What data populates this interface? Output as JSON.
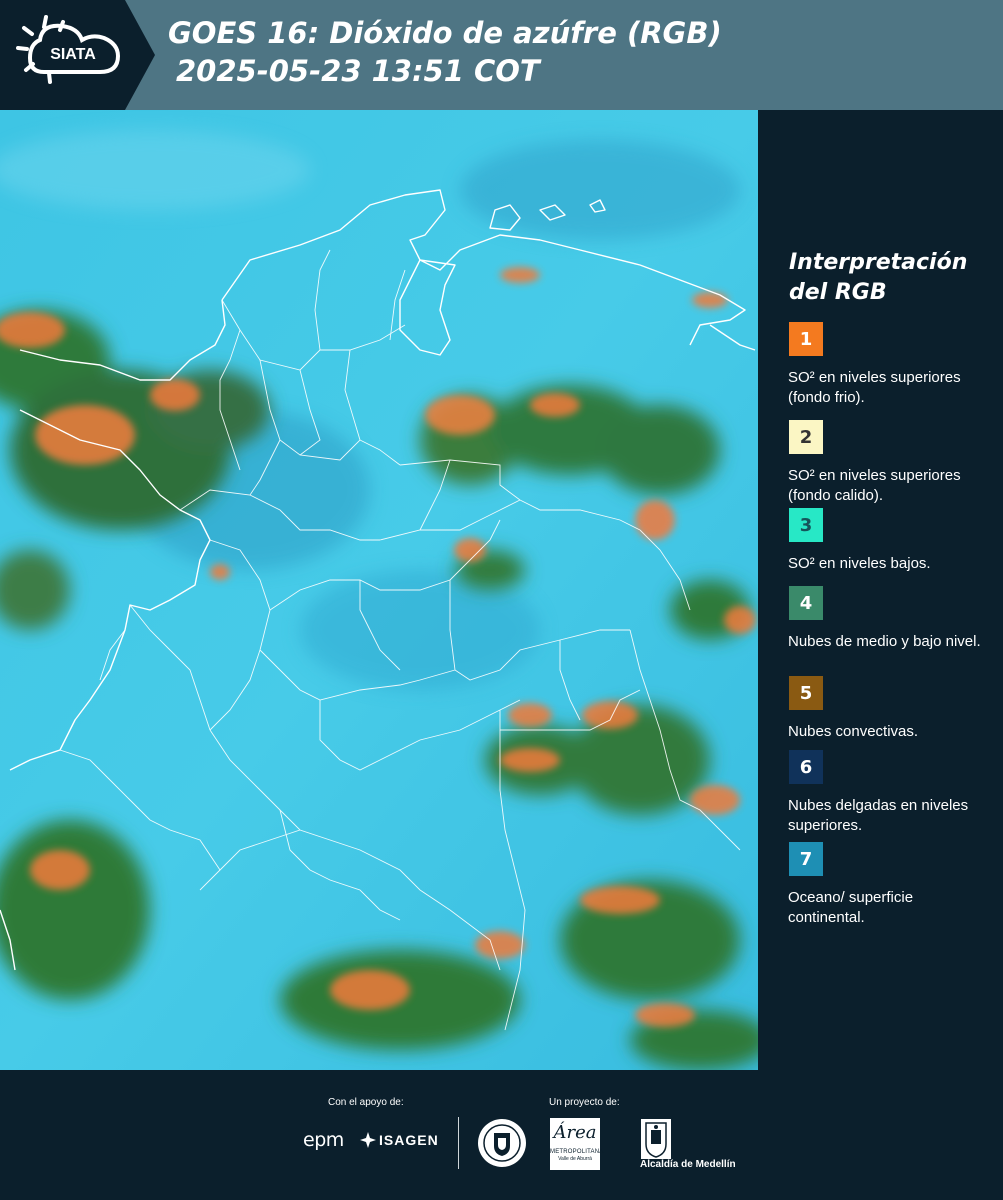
{
  "header": {
    "logo_text": "SIATA",
    "title_line1": "GOES 16: Dióxido de azúfre (RGB)",
    "title_line2": "2025-05-23 13:51 COT"
  },
  "legend": {
    "title_line1": "Interpretación",
    "title_line2": "del RGB",
    "items": [
      {
        "number": "1",
        "color": "#f47a1f",
        "text_color": "#ffffff",
        "label": "SO² en niveles superiores (fondo frio)."
      },
      {
        "number": "2",
        "color": "#fbf6c4",
        "text_color": "#333333",
        "label": "SO² en niveles superiores (fondo calido)."
      },
      {
        "number": "3",
        "color": "#27e8c6",
        "text_color": "#16555a",
        "label": "SO² en niveles bajos."
      },
      {
        "number": "4",
        "color": "#3a8a6a",
        "text_color": "#ffffff",
        "label": "Nubes de medio y bajo nivel."
      },
      {
        "number": "5",
        "color": "#8a5a12",
        "text_color": "#ffffff",
        "label": "Nubes convectivas."
      },
      {
        "number": "6",
        "color": "#10325a",
        "text_color": "#ffffff",
        "label": "Nubes delgadas en niveles superiores."
      },
      {
        "number": "7",
        "color": "#1e8fb4",
        "text_color": "#ffffff",
        "label": "Oceano/ superficie continental."
      }
    ]
  },
  "footer": {
    "support_label": "Con el apoyo de:",
    "project_label": "Un proyecto de:",
    "logo_epm": "epm",
    "logo_isagen": "ISAGEN",
    "logo_area_name": "Área",
    "logo_area_sub1": "METROPOLITANA",
    "logo_area_sub2": "Valle de Aburrá",
    "logo_medellin": "Alcaldía de Medellín"
  },
  "colors": {
    "header_bg": "#4e7584",
    "page_bg": "#0b1f2c",
    "map_base": "#3ec7e6",
    "cloud_green": "#2f7a3a",
    "cloud_orange": "#f0793a"
  }
}
